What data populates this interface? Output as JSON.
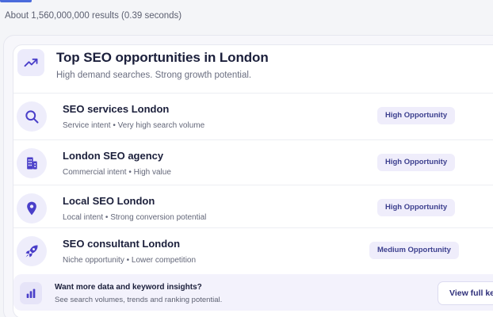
{
  "search": {
    "results_stats": "About 1,560,000,000 results (0.39 seconds)"
  },
  "panel": {
    "header_icon": "trending-up-icon",
    "title": "Top SEO opportunities in London",
    "subtitle": "High demand searches. Strong growth potential.",
    "items": [
      {
        "icon": "search-icon",
        "title": "SEO services London",
        "description": "Service intent • Very high search volume",
        "badge": "High Opportunity"
      },
      {
        "icon": "building-icon",
        "title": "London SEO agency",
        "description": "Commercial intent • High value",
        "badge": "High Opportunity"
      },
      {
        "icon": "location-pin-icon",
        "title": "Local SEO London",
        "description": "Local intent • Strong conversion potential",
        "badge": "High Opportunity"
      },
      {
        "icon": "rocket-icon",
        "title": "SEO consultant London",
        "description": "Niche opportunity • Lower competition",
        "badge": "Medium Opportunity"
      }
    ],
    "cta": {
      "icon": "bar-chart-icon",
      "title": "Want more data and keyword insights?",
      "description": "See search volumes, trends and ranking potential.",
      "button_label": "View full keyword report"
    }
  },
  "colors": {
    "accent": "#4b6bdc",
    "icon_purple": "#4a3fc9",
    "badge_bg": "#efedfb",
    "badge_text": "#3c3f8e"
  }
}
